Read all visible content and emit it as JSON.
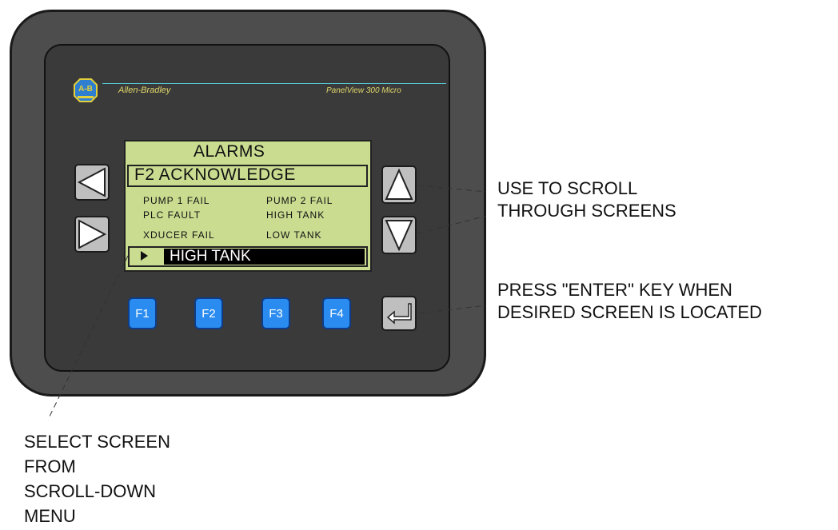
{
  "device": {
    "logo_text": "A-B",
    "brand_left": "Allen-Bradley",
    "brand_right": "PanelView 300 Micro"
  },
  "screen": {
    "title": "ALARMS",
    "header": "F2 ACKNOWLEDGE",
    "items": [
      "PUMP 1 FAIL",
      "PUMP 2 FAIL",
      "PLC FAULT",
      "HIGH TANK",
      "XDUCER FAIL",
      "LOW TANK"
    ],
    "selected": "HIGH TANK"
  },
  "function_keys": [
    "F1",
    "F2",
    "F3",
    "F4"
  ],
  "icons": {
    "left": "left-arrow-icon",
    "right": "right-arrow-icon",
    "up": "up-arrow-icon",
    "down": "down-arrow-icon",
    "enter": "enter-icon"
  },
  "callouts": {
    "scroll": [
      "USE TO SCROLL",
      "THROUGH SCREENS"
    ],
    "enter": [
      "PRESS \"ENTER\" KEY WHEN",
      "DESIRED SCREEN IS LOCATED"
    ],
    "select": [
      "SELECT SCREEN",
      "FROM",
      "SCROLL-DOWN",
      "MENU"
    ]
  },
  "colors": {
    "lcd": "#c9dc90",
    "fkey": "#2a8cf0",
    "housing": "#4d4d4d",
    "brand_text": "#e0d76a",
    "brand_line": "#56c9d4"
  }
}
